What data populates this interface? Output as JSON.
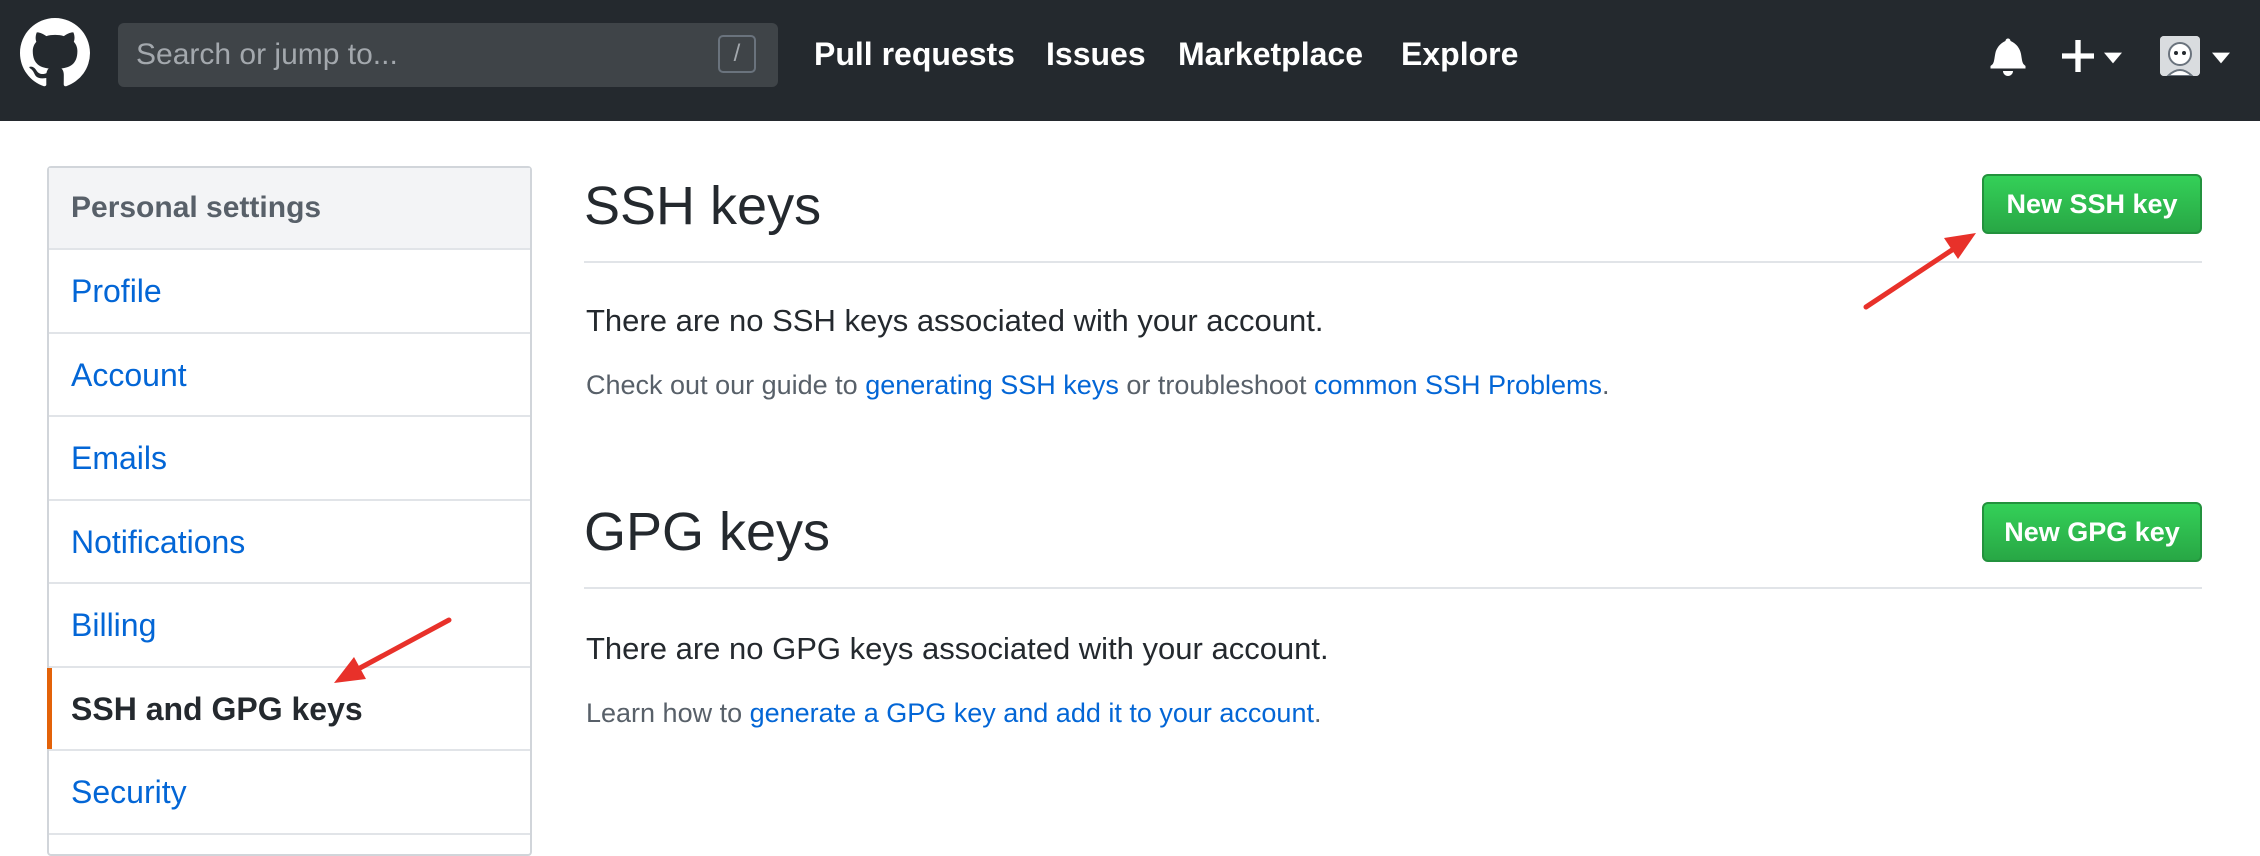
{
  "header": {
    "search_placeholder": "Search or jump to...",
    "search_shortcut": "/",
    "nav": [
      "Pull requests",
      "Issues",
      "Marketplace",
      "Explore"
    ],
    "icons": [
      "github-logo-icon",
      "bell-icon",
      "plus-icon",
      "chevron-down-icon",
      "avatar"
    ]
  },
  "sidebar": {
    "heading": "Personal settings",
    "items": [
      {
        "label": "Profile"
      },
      {
        "label": "Account"
      },
      {
        "label": "Emails"
      },
      {
        "label": "Notifications"
      },
      {
        "label": "Billing"
      },
      {
        "label": "SSH and GPG keys"
      },
      {
        "label": "Security"
      }
    ],
    "selected": "SSH and GPG keys"
  },
  "ssh": {
    "title": "SSH keys",
    "button": "New SSH key",
    "empty_message": "There are no SSH keys associated with your account.",
    "hint_prefix": "Check out our guide to ",
    "hint_link1": "generating SSH keys",
    "hint_middle": " or troubleshoot ",
    "hint_link2": "common SSH Problems",
    "hint_suffix": "."
  },
  "gpg": {
    "title": "GPG keys",
    "button": "New GPG key",
    "empty_message": "There are no GPG keys associated with your account.",
    "hint_prefix": "Learn how to ",
    "hint_link": "generate a GPG key and add it to your account",
    "hint_suffix": "."
  },
  "colors": {
    "header_bg": "#24292e",
    "link": "#0366d6",
    "button_green": "#28a745",
    "selected_accent": "#e36209",
    "annotation_arrow": "#e8312a"
  }
}
